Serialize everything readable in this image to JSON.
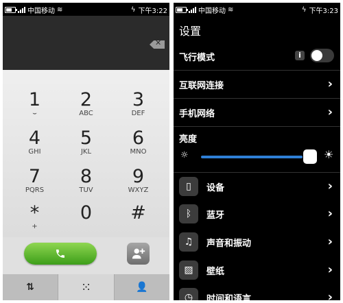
{
  "status_left": {
    "carrier": "中国移动",
    "time": "下午3:22"
  },
  "status_right": {
    "carrier": "中国移动",
    "time": "下午3:23"
  },
  "dialer": {
    "backspace": "✕",
    "keys": [
      {
        "digit": "1",
        "letters": "⌣"
      },
      {
        "digit": "2",
        "letters": "ABC"
      },
      {
        "digit": "3",
        "letters": "DEF"
      },
      {
        "digit": "4",
        "letters": "GHI"
      },
      {
        "digit": "5",
        "letters": "JKL"
      },
      {
        "digit": "6",
        "letters": "MNO"
      },
      {
        "digit": "7",
        "letters": "PQRS"
      },
      {
        "digit": "8",
        "letters": "TUV"
      },
      {
        "digit": "9",
        "letters": "WXYZ"
      },
      {
        "digit": "*",
        "letters": "+"
      },
      {
        "digit": "0",
        "letters": ""
      },
      {
        "digit": "#",
        "letters": ""
      }
    ],
    "tabs": [
      "⇅",
      "⁙",
      "👤"
    ]
  },
  "settings": {
    "title": "设置",
    "airplane": "飞行模式",
    "internet": "互联网连接",
    "mobile_network": "手机网络",
    "brightness": "亮度",
    "brightness_level": 0.91,
    "items": [
      {
        "label": "设备",
        "icon": "phone-icon"
      },
      {
        "label": "蓝牙",
        "icon": "bluetooth-icon"
      },
      {
        "label": "声音和振动",
        "icon": "sound-icon"
      },
      {
        "label": "壁纸",
        "icon": "wallpaper-icon"
      },
      {
        "label": "时间和语言",
        "icon": "clock-icon"
      }
    ]
  },
  "colors": {
    "accent": "#2f7fd6",
    "call": "#4cae25"
  }
}
